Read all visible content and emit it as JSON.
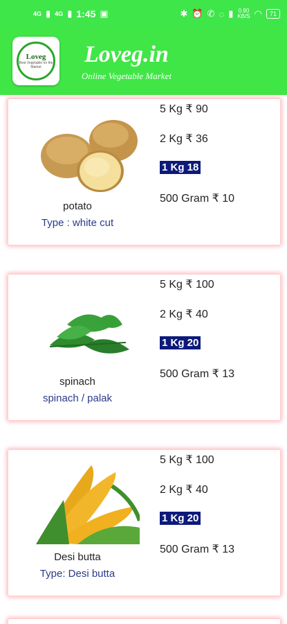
{
  "status_bar": {
    "signal1": "4G",
    "signal2": "4G",
    "time": "1:45",
    "net_speed_value": "0.90",
    "net_speed_unit": "KB/S",
    "battery": "71"
  },
  "app_bar": {
    "logo_title": "Loveg",
    "logo_sub": "Best Vegetable on the Market",
    "brand": "Loveg.in",
    "tagline": "Online Vegetable Market"
  },
  "products": [
    {
      "name": "potato",
      "type": "Type : white cut",
      "prices": [
        "5 Kg ₹ 90",
        "2 Kg ₹ 36",
        "1 Kg 18",
        "500 Gram ₹ 10"
      ]
    },
    {
      "name": "spinach",
      "type": "spinach / palak",
      "prices": [
        "5 Kg ₹ 100",
        "2 Kg ₹ 40",
        "1 Kg 20",
        "500 Gram ₹ 13"
      ]
    },
    {
      "name": "Desi butta",
      "type": "Type: Desi butta",
      "prices": [
        "5 Kg ₹ 100",
        "2 Kg ₹ 40",
        "1 Kg 20",
        "500 Gram ₹ 13"
      ]
    }
  ]
}
